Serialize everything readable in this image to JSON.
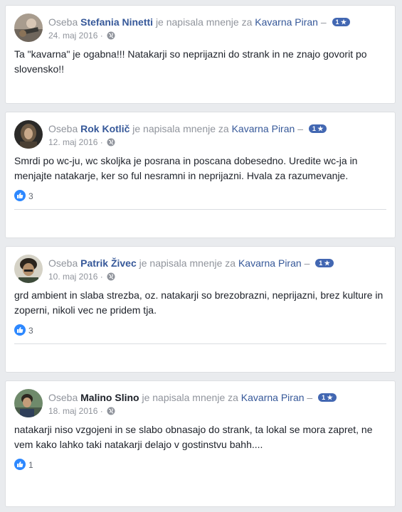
{
  "reviews": [
    {
      "prefix": "Oseba",
      "author": "Stefania Ninetti",
      "action": "je napisala mnenje za",
      "page": "Kavarna Piran",
      "dash": "–",
      "rating": "1 ★",
      "date": "24. maj 2016",
      "separator": "·",
      "text": "Ta \"kavarna\" je ogabna!!! Natakarji so neprijazni do strank in ne znajo govorit po slovensko!!",
      "likes": ""
    },
    {
      "prefix": "Oseba",
      "author": "Rok Kotlič",
      "action": "je napisala mnenje za",
      "page": "Kavarna Piran",
      "dash": "–",
      "rating": "1 ★",
      "date": "12. maj 2016",
      "separator": "·",
      "text": "Smrdi po wc-ju, wc skoljka je posrana in poscana dobesedno. Uredite wc-ja in menjajte natakarje, ker so ful nesramni in neprijazni. Hvala za razumevanje.",
      "likes": "3"
    },
    {
      "prefix": "Oseba",
      "author": "Patrik Živec",
      "action": "je napisala mnenje za",
      "page": "Kavarna Piran",
      "dash": "–",
      "rating": "1 ★",
      "date": "10. maj 2016",
      "separator": "·",
      "text": "grd ambient in slaba strezba, oz. natakarji so brezobrazni, neprijazni, brez kulture in zoperni, nikoli vec ne pridem tja.",
      "likes": "3"
    },
    {
      "prefix": "Oseba",
      "author": "Malino Slino",
      "action": "je napisala mnenje za",
      "page": "Kavarna Piran",
      "dash": "–",
      "rating": "1 ★",
      "date": "18. maj 2016",
      "separator": "·",
      "text": "natakarji niso vzgojeni in se slabo obnasajo do strank, ta lokal se mora zapret, ne vem kako lahko taki natakarji delajo v gostinstvu bahh....",
      "likes": "1"
    }
  ],
  "colors": {
    "link": "#365899",
    "meta": "#90949c",
    "rating_badge": "#4267b2",
    "like_badge": "#2d88ff",
    "background": "#e9ebee"
  },
  "icons": {
    "privacy": "globe-icon",
    "like": "thumbs-up-icon"
  }
}
